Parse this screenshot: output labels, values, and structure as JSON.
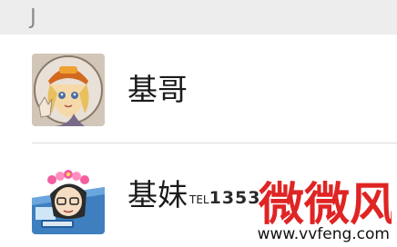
{
  "section": {
    "letter": "J"
  },
  "contacts": [
    {
      "name": "基哥"
    },
    {
      "name": "基妹",
      "tel_prefix": "TEL",
      "tel_number": "1353"
    }
  ],
  "watermark": {
    "logo_text": "微微风",
    "url": "www.vvfeng.com"
  },
  "colors": {
    "section_bg": "#ededed",
    "divider": "#dcdcdc",
    "watermark_red": "#e02424"
  }
}
